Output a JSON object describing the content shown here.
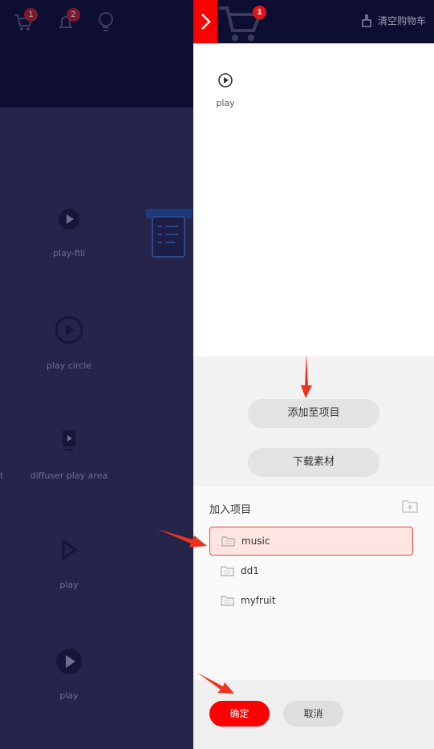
{
  "background_page": {
    "header": {
      "cart_count": "1",
      "notification_count": "2"
    },
    "icon_items": [
      {
        "label": "play-fill",
        "icon": "play-fill-icon"
      },
      {
        "label": "play circle",
        "icon": "play-circle-icon"
      },
      {
        "label": "diffuser play area",
        "icon": "diffuser-play-area-icon"
      },
      {
        "label": "play",
        "icon": "play-outline-icon"
      },
      {
        "label": "play",
        "icon": "play-filled-circle-icon"
      }
    ],
    "edge_text": "t"
  },
  "drawer": {
    "cart_count": "1",
    "clear_cart_label": "清空购物车",
    "cart_items": [
      {
        "label": "play",
        "icon": "play-circle-icon"
      }
    ],
    "add_to_project_label": "添加至项目",
    "download_label": "下载素材",
    "project_section_title": "加入项目",
    "projects": [
      {
        "name": "music",
        "selected": true
      },
      {
        "name": "dd1",
        "selected": false
      },
      {
        "name": "myfruit",
        "selected": false
      }
    ],
    "confirm_label": "确定",
    "cancel_label": "取消"
  },
  "colors": {
    "accent": "#ff0000",
    "header_bg": "#0e0e32",
    "overlay_bg": "#25244a",
    "selected_bg": "#fde5e2",
    "annotation_arrow": "#ee3322"
  }
}
